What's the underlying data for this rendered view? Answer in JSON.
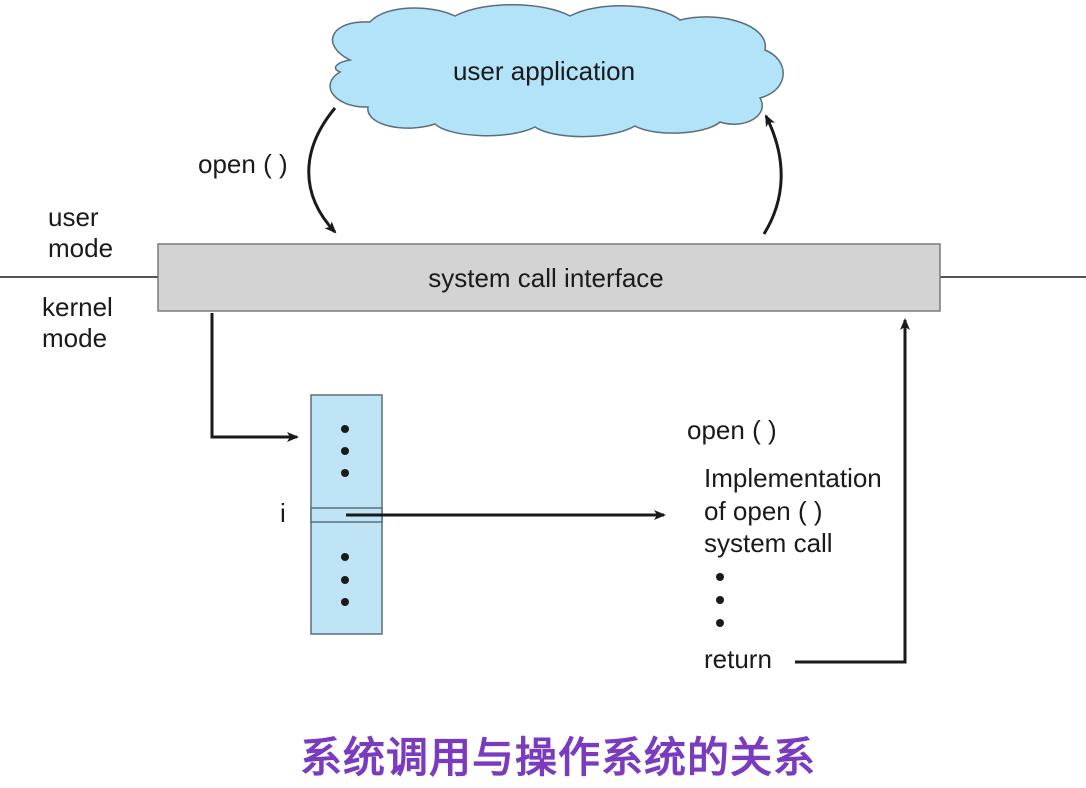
{
  "cloud": {
    "label": "user application",
    "fill": "#b3e3f8",
    "stroke": "#5a6e7a"
  },
  "call_label": "open ( )",
  "mode_labels": {
    "user": [
      "user",
      "mode"
    ],
    "kernel": [
      "kernel",
      "mode"
    ]
  },
  "interface": {
    "label": "system call interface",
    "fill": "#d3d3d3"
  },
  "table": {
    "index_label": "i",
    "fill": "#bfe4f5"
  },
  "implementation": {
    "header": "open ( )",
    "lines": [
      "Implementation",
      "of open ( )",
      "system call"
    ],
    "return_label": "return"
  },
  "caption": "系统调用与操作系统的关系",
  "colors": {
    "caption": "#7b3bbf",
    "line": "#1a1a1a"
  }
}
